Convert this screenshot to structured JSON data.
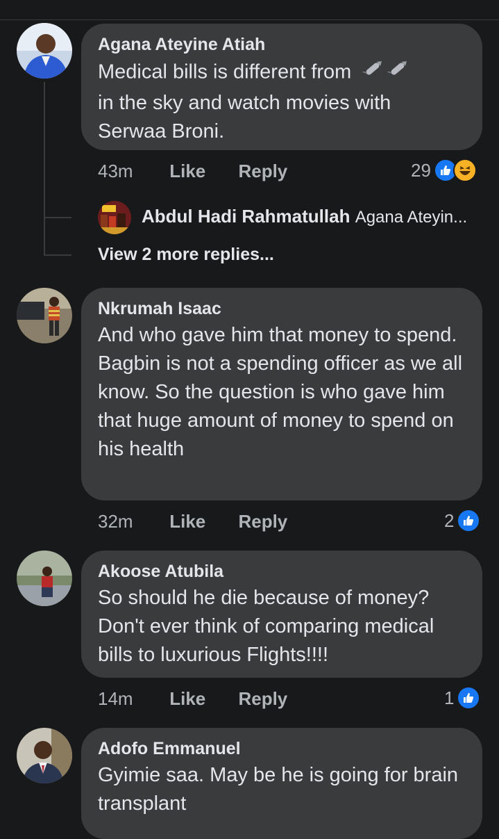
{
  "comments": [
    {
      "name": "Agana Ateyine Atiah",
      "text_line1": "Medical bills is different from",
      "text_line2": "in the sky and watch movies with",
      "text_line3": "Serwaa Broni.",
      "emoji": "rocket-emoji",
      "time": "43m",
      "like": "Like",
      "reply": "Reply",
      "reactions": "29",
      "reaction_icons": [
        "like-reaction-icon",
        "haha-reaction-icon"
      ]
    },
    {
      "name": "Nkrumah Isaac",
      "text": "And who gave him that money to spend. Bagbin is not a spending officer as we all know. So the question is who gave him that huge amount of money to spend on his health",
      "time": "32m",
      "like": "Like",
      "reply": "Reply",
      "reactions": "2"
    },
    {
      "name": "Akoose Atubila",
      "text": "So should he die because of money? Don't ever think of comparing medical bills to luxurious Flights!!!!",
      "time": "14m",
      "like": "Like",
      "reply": "Reply",
      "reactions": "1"
    },
    {
      "name": "Adofo Emmanuel",
      "text": "Gyimie saa. May be he is going for brain transplant"
    }
  ],
  "reply_preview": {
    "name": "Abdul Hadi Rahmatullah",
    "snippet": "Agana Ateyin..."
  },
  "view_more": "View 2 more replies...",
  "colors": {
    "background": "#18191a",
    "bubble": "#3a3b3c",
    "text": "#e4e6eb",
    "muted": "#b0b3b8",
    "like_blue": "#1877f2"
  }
}
